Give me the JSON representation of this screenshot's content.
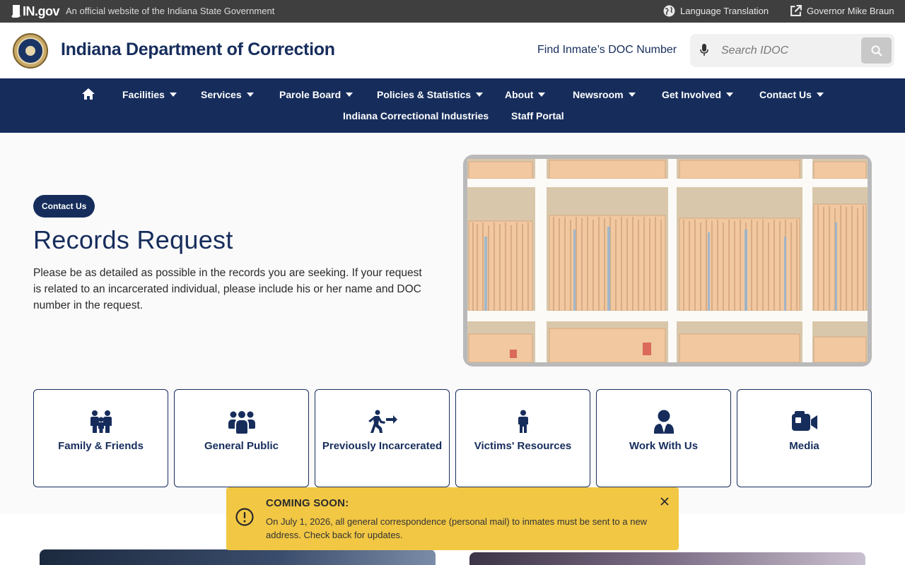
{
  "statebar": {
    "logo_text": "IN.gov",
    "official_text": "An official website of the Indiana State Government",
    "language_label": "Language Translation",
    "governor_label": "Governor Mike Braun"
  },
  "header": {
    "agency_name": "Indiana Department of Correction",
    "find_inmate_label": "Find Inmate’s DOC Number",
    "search_placeholder": "Search IDOC"
  },
  "nav": {
    "items": [
      {
        "label": "Facilities"
      },
      {
        "label": "Services"
      },
      {
        "label": "Parole Board"
      },
      {
        "label": "Policies & Statistics"
      },
      {
        "label": "About"
      },
      {
        "label": "Newsroom"
      },
      {
        "label": "Get Involved"
      },
      {
        "label": "Contact Us"
      },
      {
        "label": "Indiana Correctional Industries"
      },
      {
        "label": "Staff Portal"
      }
    ]
  },
  "hero": {
    "badge": "Contact Us",
    "title": "Records Request",
    "intro": "Please be as detailed as possible in the records you are seeking. If your request is related to an incarcerated individual, please include his or her name and DOC number in the request."
  },
  "cards": [
    {
      "label": "Family & Friends",
      "icon": "family-icon"
    },
    {
      "label": "General Public",
      "icon": "people-group-icon"
    },
    {
      "label": "Previously Incarcerated",
      "icon": "person-walking-arrow-icon"
    },
    {
      "label": "Victims' Resources",
      "icon": "person-icon"
    },
    {
      "label": "Work With Us",
      "icon": "user-tie-icon"
    },
    {
      "label": "Media",
      "icon": "video-camera-icon"
    }
  ],
  "alert": {
    "heading": "COMING SOON:",
    "body": "On July 1, 2026, all general correspondence (personal mail) to inmates must be sent to a new address. Check back for updates."
  },
  "colors": {
    "brand_navy": "#162d5c",
    "statebar_gray": "#3f3f3f",
    "alert_yellow": "#f2c744"
  }
}
